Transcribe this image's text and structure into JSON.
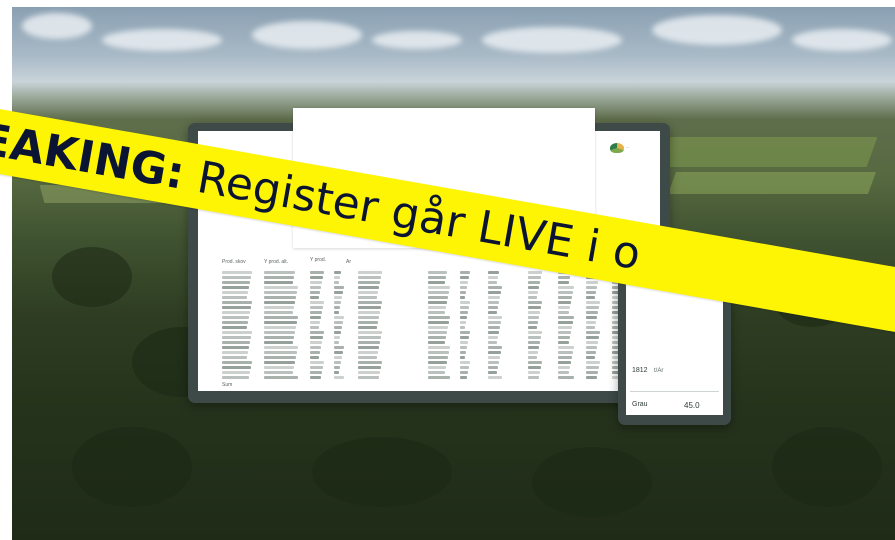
{
  "banner": {
    "lead": "EAKING:",
    "rest": " Register går LIVE i o"
  },
  "dashboard_main": {
    "logo_text": "...",
    "table_header": [
      "Prod. skov",
      "Y prod. alt.",
      "Y prod.",
      "Ar"
    ],
    "footer_label": "Sum"
  },
  "dashboard_side": {
    "stat_1_value": "1812",
    "stat_1_unit": "t/Ar",
    "stat_2_label": "Grau",
    "stat_2_value": "45.0"
  },
  "colors": {
    "banner_bg": "#fef504",
    "banner_text": "#0c1433",
    "device_frame": "#3e4a47",
    "bar_fill": "#d9b99a"
  }
}
